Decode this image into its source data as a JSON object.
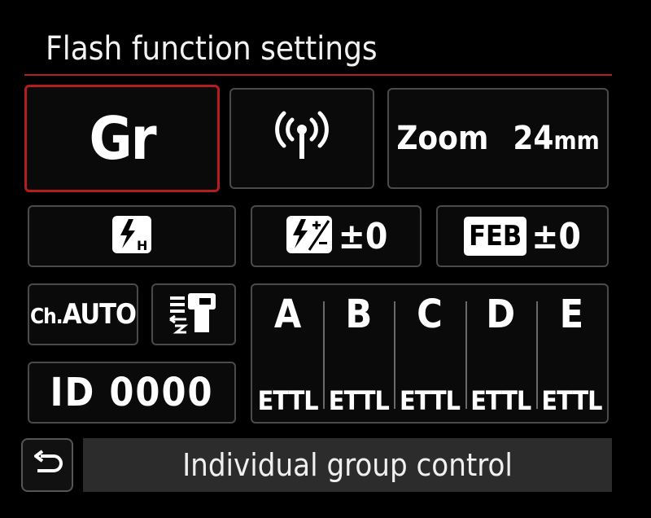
{
  "screen": {
    "title": "Flash function settings",
    "accent_color": "#b51c1c"
  },
  "tiles": {
    "group_mode": "Gr",
    "wireless_icon": "wireless-radio-icon",
    "zoom_label": "Zoom",
    "zoom_value": "24",
    "zoom_unit": "mm",
    "sync_mode_icon": "high-speed-sync-icon",
    "flash_comp_icon": "flash-exposure-compensation-icon",
    "flash_comp_value": "±0",
    "feb_badge": "FEB",
    "feb_value": "±0",
    "channel_prefix": "Ch.",
    "channel_value": "AUTO",
    "modeling_flash_icon": "modeling-flash-icon",
    "wireless_id": "ID 0000"
  },
  "groups": [
    {
      "letter": "A",
      "mode": "ETTL"
    },
    {
      "letter": "B",
      "mode": "ETTL"
    },
    {
      "letter": "C",
      "mode": "ETTL"
    },
    {
      "letter": "D",
      "mode": "ETTL"
    },
    {
      "letter": "E",
      "mode": "ETTL"
    }
  ],
  "footer": {
    "back_icon": "return-arrow-icon",
    "status_text": "Individual group control"
  }
}
